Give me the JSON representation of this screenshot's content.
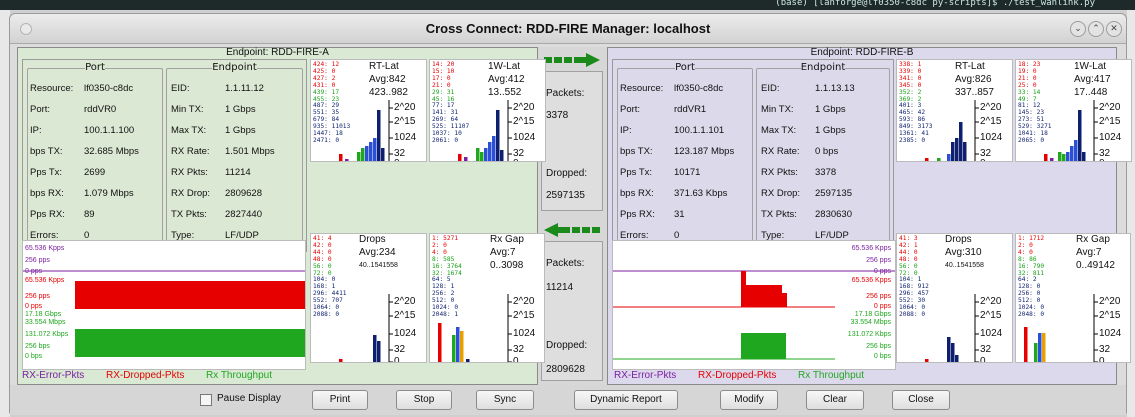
{
  "terminal": {
    "text": "(base) [lanforge@lf0350-c8dc py-scripts]$ ./test_wanlink.py"
  },
  "window": {
    "title": "Cross Connect: RDD-FIRE  Manager: localhost"
  },
  "titlebar_buttons": {
    "minimize": "⌄",
    "maximize": "⌃",
    "close": "✕"
  },
  "endpoints": [
    {
      "header": "Endpoint: RDD-FIRE-A",
      "port_label": "Port",
      "endpoint_label": "Endpoint",
      "port": [
        [
          "Resource:",
          "lf0350-c8dc"
        ],
        [
          "Port:",
          "rddVR0"
        ],
        [
          "IP:",
          "100.1.1.100"
        ],
        [
          "bps TX:",
          "32.685 Mbps"
        ],
        [
          "Pps Tx:",
          "2699"
        ],
        [
          "bps RX:",
          "1.079 Mbps"
        ],
        [
          "Pps RX:",
          "89"
        ],
        [
          "Errors:",
          "0"
        ]
      ],
      "ep": [
        [
          "EID:",
          "1.1.11.12"
        ],
        [
          "Min TX:",
          "1 Gbps"
        ],
        [
          "Max TX:",
          "1 Gbps"
        ],
        [
          "RX Rate:",
          "1.501 Mbps"
        ],
        [
          "RX Pkts:",
          "11214"
        ],
        [
          "RX Drop:",
          "2809628"
        ],
        [
          "TX Pkts:",
          "2827440"
        ],
        [
          "Type:",
          "LF/UDP"
        ]
      ],
      "rt": {
        "title": "RT-Lat",
        "avg": "Avg:842",
        "range": "423..982",
        "buckets_red": [
          "424: 12",
          "425: 0",
          "427: 2",
          "431: 0"
        ],
        "buckets_green": [
          "439: 17",
          "455: 23"
        ],
        "buckets_blue": [
          "487: 29",
          "551: 35",
          "679: 84",
          "935: 11013",
          "1447: 18",
          "2471: 0"
        ],
        "ticks": [
          "2^20",
          "2^15",
          "1024",
          "32",
          "0"
        ]
      },
      "w1": {
        "title": "1W-Lat",
        "avg": "Avg:412",
        "range": "13..552",
        "buckets_red": [
          "14: 20",
          "15: 10",
          "17: 0",
          "21: 0"
        ],
        "buckets_green": [
          "29: 31",
          "45: 16"
        ],
        "buckets_blue": [
          "77: 17",
          "141: 31",
          "269: 64",
          "525: 11107",
          "1037: 10",
          "2061: 0"
        ],
        "ticks": [
          "2^20",
          "2^15",
          "1024",
          "32",
          "0"
        ]
      },
      "drops": {
        "title": "Drops",
        "avg": "Avg:234",
        "range": "40..1541558",
        "buckets_red": [
          "41: 4",
          "42: 0",
          "44: 0",
          "48: 0"
        ],
        "buckets_green": [
          "56: 0",
          "72: 0"
        ],
        "buckets_blue": [
          "104: 0",
          "168: 1",
          "296: 4411",
          "552: 707",
          "1064: 0",
          "2088: 0"
        ],
        "ticks": [
          "2^20",
          "2^15",
          "1024",
          "32",
          "0"
        ]
      },
      "gap": {
        "title": "Rx Gap",
        "avg": "Avg:7",
        "range": "0..3098",
        "buckets_red": [
          "1: 5271",
          "2: 0",
          "4: 0"
        ],
        "buckets_green": [
          "8: 585",
          "16: 3764",
          "32: 1674"
        ],
        "buckets_blue": [
          "64: 5",
          "128: 1",
          "256: 2",
          "512: 0",
          "1024: 0",
          "2048: 1"
        ],
        "ticks": [
          "2^20",
          "2^15",
          "1024",
          "32",
          "0"
        ]
      },
      "graph": {
        "err_axis": [
          "65.536 Kpps",
          "256 pps",
          "0 pps"
        ],
        "drop_axis": [
          "65.536 Kpps",
          "256 pps",
          "0 pps"
        ],
        "tp_axis": [
          "17.18 Gbps",
          "33.554 Mbps",
          "131.072 Kbps",
          "256 bps",
          "0 bps"
        ]
      },
      "legend": [
        "RX-Error-Pkts",
        "RX-Dropped-Pkts",
        "Rx Throughput"
      ]
    },
    {
      "header": "Endpoint: RDD-FIRE-B",
      "port_label": "Port",
      "endpoint_label": "Endpoint",
      "port": [
        [
          "Resource:",
          "lf0350-c8dc"
        ],
        [
          "Port:",
          "rddVR1"
        ],
        [
          "IP:",
          "100.1.1.101"
        ],
        [
          "bps TX:",
          "123.187 Mbps"
        ],
        [
          "Pps Tx:",
          "10171"
        ],
        [
          "bps RX:",
          "371.63 Kbps"
        ],
        [
          "Pps RX:",
          "31"
        ],
        [
          "Errors:",
          "0"
        ]
      ],
      "ep": [
        [
          "EID:",
          "1.1.13.13"
        ],
        [
          "Min TX:",
          "1 Gbps"
        ],
        [
          "Max TX:",
          "1 Gbps"
        ],
        [
          "RX Rate:",
          "0 bps"
        ],
        [
          "RX Pkts:",
          "3378"
        ],
        [
          "RX Drop:",
          "2597135"
        ],
        [
          "TX Pkts:",
          "2830630"
        ],
        [
          "Type:",
          "LF/UDP"
        ]
      ],
      "rt": {
        "title": "RT-Lat",
        "avg": "Avg:826",
        "range": "337..857",
        "buckets_red": [
          "338: 1",
          "339: 0",
          "341: 0",
          "345: 0"
        ],
        "buckets_green": [
          "352: 2",
          "369: 2"
        ],
        "buckets_blue": [
          "401: 3",
          "465: 42",
          "593: 86",
          "849: 3173",
          "1361: 41",
          "2385: 0"
        ],
        "ticks": [
          "2^20",
          "2^15",
          "1024",
          "32",
          "0"
        ]
      },
      "w1": {
        "title": "1W-Lat",
        "avg": "Avg:417",
        "range": "17..448",
        "buckets_red": [
          "18: 23",
          "19: 0",
          "21: 0",
          "25: 0"
        ],
        "buckets_green": [
          "33: 14",
          "49: 7"
        ],
        "buckets_blue": [
          "81: 12",
          "145: 23",
          "273: 51",
          "529: 3271",
          "1041: 18",
          "2065: 0"
        ],
        "ticks": [
          "2^20",
          "2^15",
          "1024",
          "32",
          "0"
        ]
      },
      "drops": {
        "title": "Drops",
        "avg": "Avg:310",
        "range": "40..1541558",
        "buckets_red": [
          "41: 3",
          "42: 1",
          "44: 0",
          "48: 0"
        ],
        "buckets_green": [
          "56: 0",
          "72: 0"
        ],
        "buckets_blue": [
          "104: 1",
          "168: 912",
          "296: 457",
          "552: 30",
          "1064: 0",
          "2088: 0"
        ],
        "ticks": [
          "2^20",
          "2^15",
          "1024",
          "32",
          "0"
        ]
      },
      "gap": {
        "title": "Rx Gap",
        "avg": "Avg:7",
        "range": "0..49142",
        "buckets_red": [
          "1: 1712",
          "2: 0",
          "4: 0"
        ],
        "buckets_green": [
          "8: 86",
          "16: 790",
          "32: 811"
        ],
        "buckets_blue": [
          "64: 2",
          "128: 0",
          "256: 0",
          "512: 0",
          "1024: 0",
          "2048: 0"
        ],
        "ticks": [
          "2^20",
          "2^15",
          "1024",
          "32",
          "0"
        ]
      },
      "graph": {
        "err_axis": [
          "65.536 Kpps",
          "256 pps",
          "0 pps"
        ],
        "drop_axis": [
          "65.536 Kpps",
          "256 pps",
          "0 pps"
        ],
        "tp_axis": [
          "17.18 Gbps",
          "33.554 Mbps",
          "131.072 Kbps",
          "256 bps",
          "0 bps"
        ]
      },
      "legend": [
        "RX-Error-Pkts",
        "RX-Dropped-Pkts",
        "Rx Throughput"
      ]
    }
  ],
  "center": {
    "packets_label": "Packets:",
    "dropped_label": "Dropped:",
    "top_packets": "3378",
    "top_dropped": "2597135",
    "bottom_packets": "11214",
    "bottom_dropped": "2809628"
  },
  "footer": {
    "pause": "Pause Display",
    "print": "Print",
    "stop": "Stop",
    "sync": "Sync",
    "report": "Dynamic Report",
    "modify": "Modify",
    "clear": "Clear",
    "close": "Close"
  },
  "colors": {
    "green_panel": "#d9e9d4",
    "purple_panel": "#ddd9ec",
    "error": "#7b1fa2",
    "dropped": "#e60000",
    "throughput": "#1fa81f",
    "bar_blue": "#0d1f6e"
  }
}
